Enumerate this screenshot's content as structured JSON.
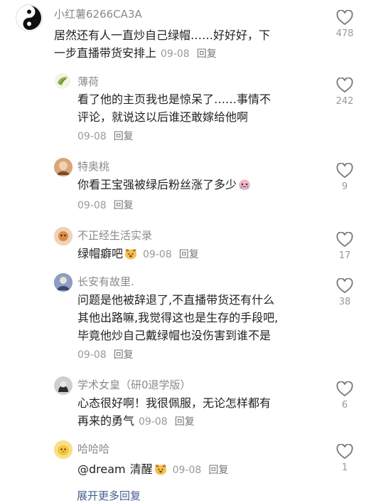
{
  "comments": [
    {
      "user": "小红薯6266CA3A",
      "lines": [
        "居然还有人一直炒自己绿帽……好好好，下",
        "一步直播带货安排上"
      ],
      "date": "09-08",
      "reply": "回复",
      "likes": "478"
    },
    {
      "user": "薄荷",
      "lines": [
        "看了他的主页我也是惊呆了……事情不",
        "评论，就说这以后谁还敢嫁给他啊"
      ],
      "date": "09-08",
      "reply": "回复",
      "likes": "242"
    },
    {
      "user": "特奥桃",
      "lines": [
        "你看王宝强被绿后粉丝涨了多少"
      ],
      "date": "09-08",
      "reply": "回复",
      "likes": "9"
    },
    {
      "user": "不正经生活实录",
      "lines": [
        "绿帽癖吧"
      ],
      "date": "09-08",
      "reply": "回复",
      "likes": "17"
    },
    {
      "user": "长安有故里.",
      "lines": [
        "问题是他被辞退了,不直播带货还有什么",
        "其他出路嘛,我觉得这也是生存的手段吧,",
        "毕竟他炒自己戴绿帽也没伤害到谁不是"
      ],
      "date": "09-08",
      "reply": "回复",
      "likes": "38"
    },
    {
      "user": "学术女皇（研0退学版）",
      "lines": [
        "心态很好啊！我很佩服，无论怎样都有",
        "再来的勇气"
      ],
      "date": "09-08",
      "reply": "回复",
      "likes": "6"
    },
    {
      "user": "哈哈哈",
      "mention": "@dream",
      "lines": [
        "清醒"
      ],
      "date": "09-08",
      "reply": "回复",
      "likes": "1"
    }
  ],
  "load_more": "展开更多回复"
}
